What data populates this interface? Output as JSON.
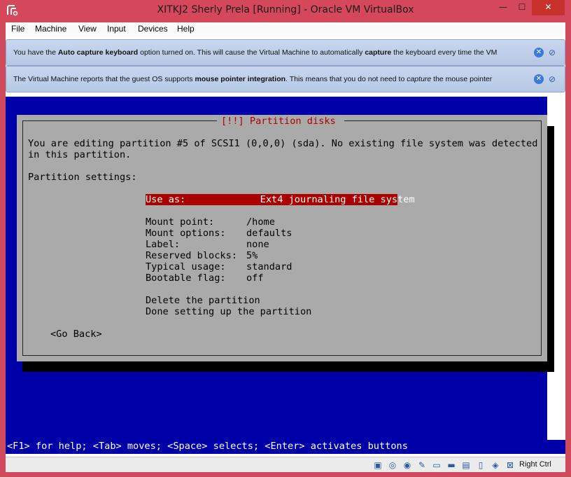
{
  "window": {
    "title": "XITKJ2 Sherly Prela [Running] - Oracle VM VirtualBox",
    "min_label": "—",
    "max_label": "☐",
    "close_label": "✕"
  },
  "menu": [
    "File",
    "Machine",
    "View",
    "Input",
    "Devices",
    "Help"
  ],
  "notices": {
    "keyboard": {
      "t1": "You have the ",
      "b1": "Auto capture keyboard",
      "t2": " option turned on. This will cause the Virtual Machine to automatically ",
      "b2": "capture",
      "t3": " the keyboard every time the VM"
    },
    "mouse": {
      "t1": "The Virtual Machine reports that the guest OS supports ",
      "b1": "mouse pointer integration",
      "t2": ". This means that you do not need to ",
      "i1": "capture",
      "t3": " the mouse pointer"
    },
    "close_glyph": "✕",
    "mouse_glyph": "⊘"
  },
  "installer": {
    "dialog_title": "[!!] Partition disks",
    "intro_line1": "You are editing partition #5 of SCSI1 (0,0,0) (sda). No existing file system was detected",
    "intro_line2": "in this partition.",
    "settings_heading": "Partition settings:",
    "selected_row": "Use as:             Ext4 journaling file system",
    "settings": [
      {
        "label": "Mount point:",
        "value": "/home"
      },
      {
        "label": "Mount options:",
        "value": "defaults"
      },
      {
        "label": "Label:",
        "value": "none"
      },
      {
        "label": "Reserved blocks:",
        "value": "5%"
      },
      {
        "label": "Typical usage:",
        "value": "standard"
      },
      {
        "label": "Bootable flag:",
        "value": "off"
      }
    ],
    "actions": [
      "Delete the partition",
      "Done setting up the partition"
    ],
    "go_back": "<Go Back>",
    "help_line": "<F1> for help; <Tab> moves; <Space> selects; <Enter> activates buttons"
  },
  "statusbar": {
    "icons": [
      "hard-disk-icon",
      "optical-disk-icon",
      "audio-icon",
      "usb-icon",
      "shared-folder-icon",
      "display-icon",
      "video-capture-icon",
      "network-icon",
      "guest-additions-icon",
      "mouse-integration-icon",
      "keyboard-icon"
    ],
    "host_key": "Right Ctrl"
  },
  "colors": {
    "frame": "#d5485c",
    "vm_background": "#0000a8",
    "dialog": "#aaaaaa",
    "selection": "#aa0000",
    "dialog_title": "#b00000"
  }
}
